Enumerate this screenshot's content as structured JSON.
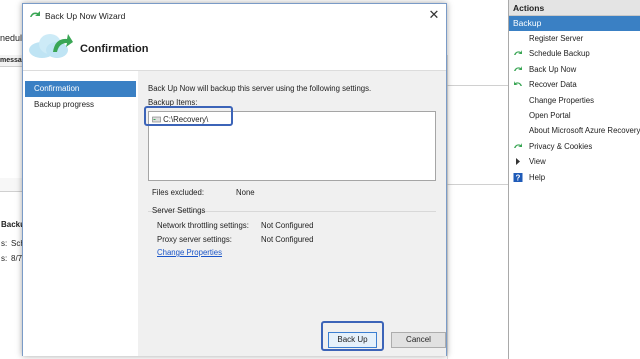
{
  "background": {
    "partial_labels": [
      "nedul",
      "messa",
      "Backu",
      "s:",
      "Sche",
      "s:",
      "8/7"
    ]
  },
  "actions": {
    "header": "Actions",
    "section": "Backup",
    "items": [
      {
        "label": "Register Server",
        "icon": "none"
      },
      {
        "label": "Schedule Backup",
        "icon": "schedule-backup-icon"
      },
      {
        "label": "Back Up Now",
        "icon": "backup-now-icon"
      },
      {
        "label": "Recover Data",
        "icon": "recover-data-icon"
      },
      {
        "label": "Change Properties",
        "icon": "none"
      },
      {
        "label": "Open Portal",
        "icon": "none"
      },
      {
        "label": "About Microsoft Azure Recovery",
        "icon": "none"
      },
      {
        "label": "Privacy & Cookies",
        "icon": "privacy-icon"
      },
      {
        "label": "View",
        "icon": "view-arrow-icon"
      },
      {
        "label": "Help",
        "icon": "help-icon"
      }
    ]
  },
  "wizard": {
    "title": "Back Up Now Wizard",
    "heading": "Confirmation",
    "nav": [
      "Confirmation",
      "Backup progress"
    ],
    "intro": "Back Up Now will backup this server using the following settings.",
    "backup_items_label": "Backup Items:",
    "backup_items": [
      "C:\\Recovery\\"
    ],
    "files_excluded_label": "Files excluded:",
    "files_excluded_value": "None",
    "server_settings_label": "Server Settings",
    "network_label": "Network throttling settings:",
    "network_value": "Not Configured",
    "proxy_label": "Proxy server settings:",
    "proxy_value": "Not Configured",
    "change_properties_link": "Change Properties",
    "back_up_button": "Back Up",
    "cancel_button": "Cancel"
  },
  "colors": {
    "accent": "#3a80c4",
    "highlight_box": "#3c64b8",
    "link": "#1a55c8"
  }
}
